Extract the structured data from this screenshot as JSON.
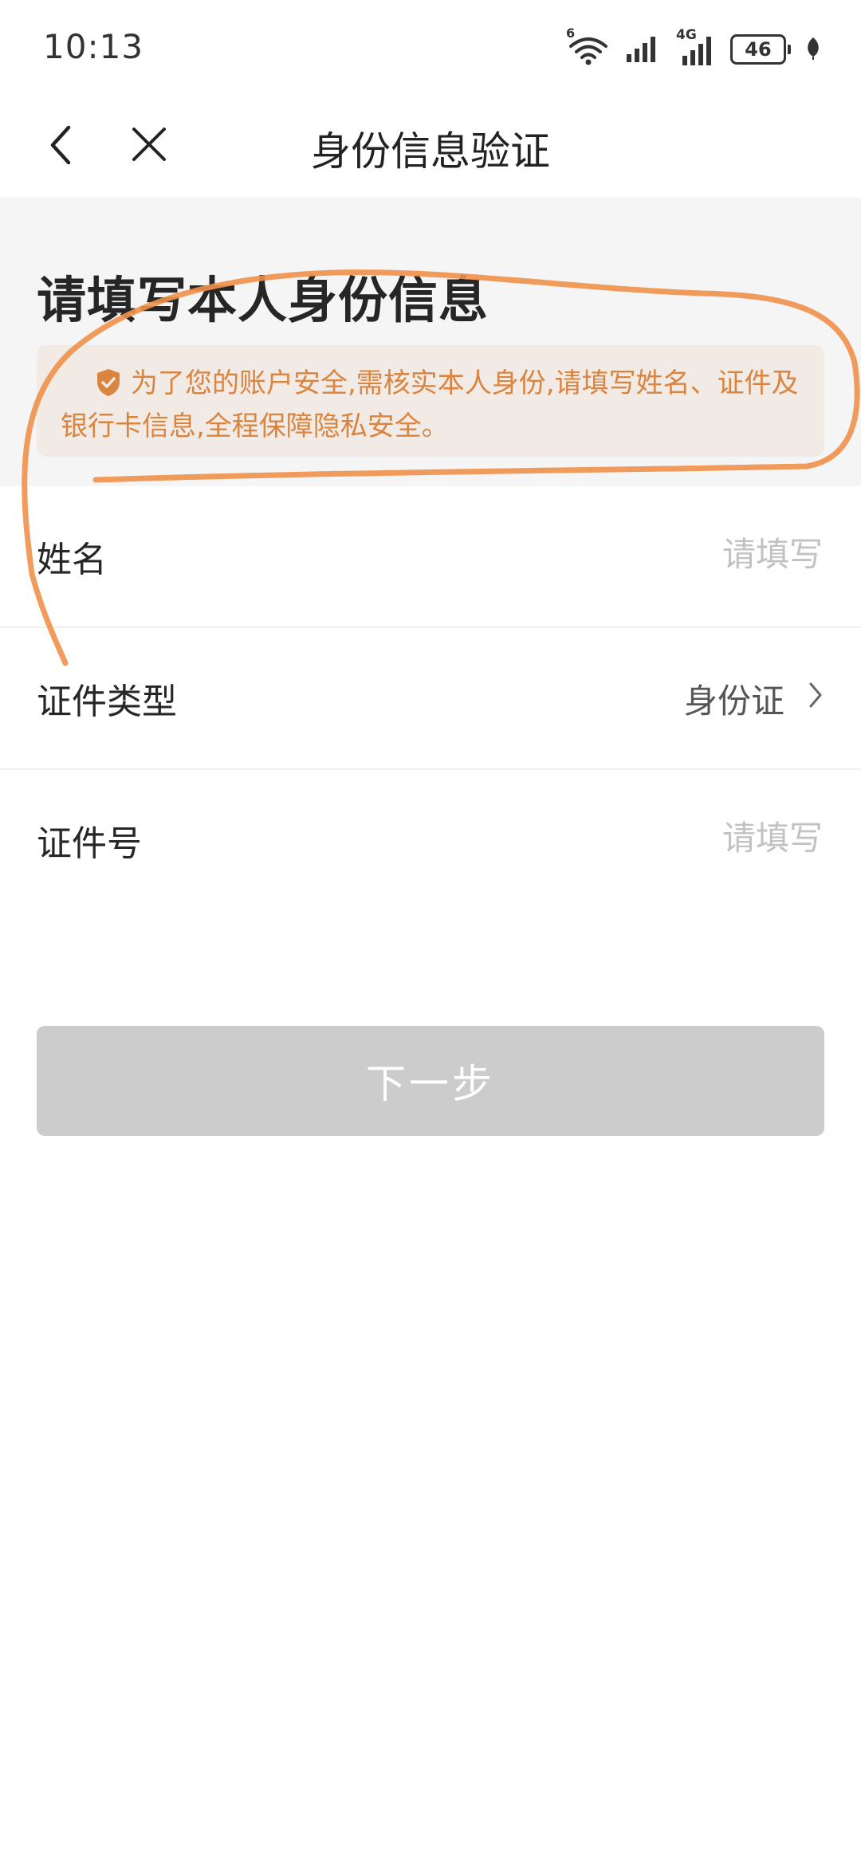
{
  "status_bar": {
    "time": "10:13",
    "wifi_label": "6",
    "network_label": "4G",
    "battery_level": "46"
  },
  "nav": {
    "title": "身份信息验证"
  },
  "header": {
    "title": "请填写本人身份信息",
    "notice": "为了您的账户安全,需核实本人身份,请填写姓名、证件及银行卡信息,全程保障隐私安全。"
  },
  "form": {
    "name_label": "姓名",
    "name_placeholder": "请填写",
    "id_type_label": "证件类型",
    "id_type_value": "身份证",
    "id_number_label": "证件号",
    "id_number_placeholder": "请填写"
  },
  "next_button": {
    "label": "下一步"
  },
  "colors": {
    "accent_orange": "#d9843f",
    "annotation_orange": "#f0914a",
    "notice_bg": "#f1eae5",
    "button_disabled": "#cccccc",
    "section_bg": "#f5f5f5"
  },
  "icons": {
    "back": "chevron-left-icon",
    "close": "close-icon",
    "notice": "shield-check-icon",
    "row_arrow": "chevron-right-icon",
    "wifi": "wifi-icon",
    "signal": "signal-icon",
    "battery": "battery-icon",
    "leaf": "leaf-icon"
  }
}
